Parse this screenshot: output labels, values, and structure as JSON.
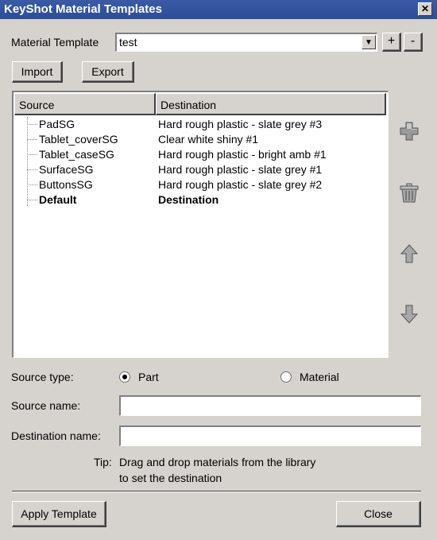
{
  "window": {
    "title": "KeyShot Material Templates",
    "close_glyph": "✕"
  },
  "template": {
    "label": "Material Template",
    "selected": "test",
    "add_label": "+",
    "remove_label": "-"
  },
  "buttons": {
    "import": "Import",
    "export": "Export"
  },
  "table": {
    "headers": [
      "Source",
      "Destination"
    ],
    "rows": [
      {
        "source": "PadSG",
        "destination": "Hard rough plastic - slate grey #3",
        "bold": false
      },
      {
        "source": "Tablet_coverSG",
        "destination": "Clear white shiny #1",
        "bold": false
      },
      {
        "source": "Tablet_caseSG",
        "destination": "Hard rough plastic - bright amb #1",
        "bold": false
      },
      {
        "source": "SurfaceSG",
        "destination": "Hard rough plastic - slate grey #1",
        "bold": false
      },
      {
        "source": "ButtonsSG",
        "destination": "Hard rough plastic - slate grey #2",
        "bold": false
      },
      {
        "source": "Default",
        "destination": "Destination",
        "bold": true
      }
    ]
  },
  "side_buttons": [
    "add-icon",
    "trash-icon",
    "arrow-up-icon",
    "arrow-down-icon"
  ],
  "source_type": {
    "label": "Source type:",
    "options": [
      "Part",
      "Material"
    ],
    "selected": "Part"
  },
  "source_name": {
    "label": "Source name:",
    "value": ""
  },
  "destination_name": {
    "label": "Destination name:",
    "value": ""
  },
  "tip": {
    "label": "Tip:",
    "line1": "Drag and drop materials from the library",
    "line2": "to set the destination"
  },
  "footer": {
    "apply": "Apply Template",
    "close": "Close"
  }
}
